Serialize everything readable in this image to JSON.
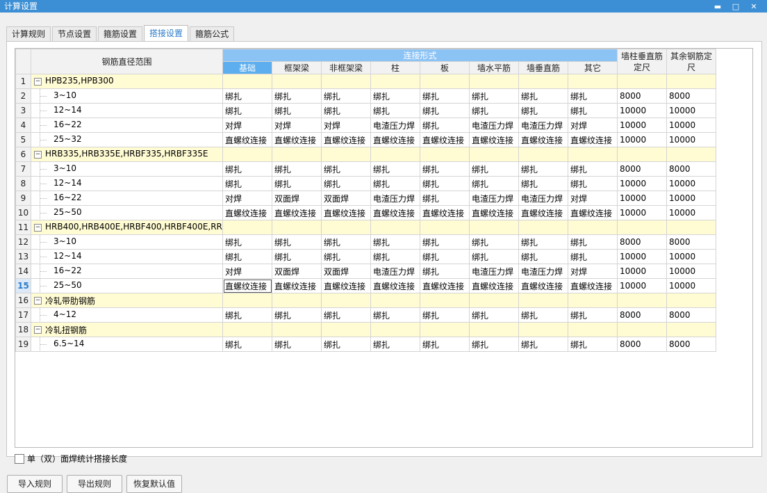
{
  "window": {
    "title": "计算设置",
    "controls": [
      "▬",
      "□",
      "✕"
    ]
  },
  "tabs": [
    {
      "label": "计算规则",
      "active": false
    },
    {
      "label": "节点设置",
      "active": false
    },
    {
      "label": "箍筋设置",
      "active": false
    },
    {
      "label": "搭接设置",
      "active": true
    },
    {
      "label": "箍筋公式",
      "active": false
    }
  ],
  "table": {
    "range_header": "钢筋直径范围",
    "connection_header": "连接形式",
    "sub_headers": [
      "基础",
      "框架梁",
      "非框架梁",
      "柱",
      "板",
      "墙水平筋",
      "墙垂直筋",
      "其它"
    ],
    "wall_col_header": "墙柱垂直筋定尺",
    "other_col_header": "其余钢筋定尺",
    "rows": [
      {
        "n": "1",
        "group": true,
        "label": "HPB235,HPB300"
      },
      {
        "n": "2",
        "range": "3~10",
        "cells": [
          "绑扎",
          "绑扎",
          "绑扎",
          "绑扎",
          "绑扎",
          "绑扎",
          "绑扎",
          "绑扎",
          "8000",
          "8000"
        ]
      },
      {
        "n": "3",
        "range": "12~14",
        "cells": [
          "绑扎",
          "绑扎",
          "绑扎",
          "绑扎",
          "绑扎",
          "绑扎",
          "绑扎",
          "绑扎",
          "10000",
          "10000"
        ]
      },
      {
        "n": "4",
        "range": "16~22",
        "cells": [
          "对焊",
          "对焊",
          "对焊",
          "电渣压力焊",
          "绑扎",
          "电渣压力焊",
          "电渣压力焊",
          "对焊",
          "10000",
          "10000"
        ]
      },
      {
        "n": "5",
        "range": "25~32",
        "cells": [
          "直螺纹连接",
          "直螺纹连接",
          "直螺纹连接",
          "直螺纹连接",
          "直螺纹连接",
          "直螺纹连接",
          "直螺纹连接",
          "直螺纹连接",
          "10000",
          "10000"
        ]
      },
      {
        "n": "6",
        "group": true,
        "label": "HRB335,HRB335E,HRBF335,HRBF335E"
      },
      {
        "n": "7",
        "range": "3~10",
        "cells": [
          "绑扎",
          "绑扎",
          "绑扎",
          "绑扎",
          "绑扎",
          "绑扎",
          "绑扎",
          "绑扎",
          "8000",
          "8000"
        ]
      },
      {
        "n": "8",
        "range": "12~14",
        "cells": [
          "绑扎",
          "绑扎",
          "绑扎",
          "绑扎",
          "绑扎",
          "绑扎",
          "绑扎",
          "绑扎",
          "10000",
          "10000"
        ]
      },
      {
        "n": "9",
        "range": "16~22",
        "cells": [
          "对焊",
          "双面焊",
          "双面焊",
          "电渣压力焊",
          "绑扎",
          "电渣压力焊",
          "电渣压力焊",
          "对焊",
          "10000",
          "10000"
        ]
      },
      {
        "n": "10",
        "range": "25~50",
        "cells": [
          "直螺纹连接",
          "直螺纹连接",
          "直螺纹连接",
          "直螺纹连接",
          "直螺纹连接",
          "直螺纹连接",
          "直螺纹连接",
          "直螺纹连接",
          "10000",
          "10000"
        ]
      },
      {
        "n": "11",
        "group": true,
        "label": "HRB400,HRB400E,HRBF400,HRBF400E,RR..."
      },
      {
        "n": "12",
        "range": "3~10",
        "cells": [
          "绑扎",
          "绑扎",
          "绑扎",
          "绑扎",
          "绑扎",
          "绑扎",
          "绑扎",
          "绑扎",
          "8000",
          "8000"
        ]
      },
      {
        "n": "13",
        "range": "12~14",
        "cells": [
          "绑扎",
          "绑扎",
          "绑扎",
          "绑扎",
          "绑扎",
          "绑扎",
          "绑扎",
          "绑扎",
          "10000",
          "10000"
        ]
      },
      {
        "n": "14",
        "range": "16~22",
        "cells": [
          "对焊",
          "双面焊",
          "双面焊",
          "电渣压力焊",
          "绑扎",
          "电渣压力焊",
          "电渣压力焊",
          "对焊",
          "10000",
          "10000"
        ]
      },
      {
        "n": "15",
        "range": "25~50",
        "selected": true,
        "cells": [
          "直螺纹连接",
          "直螺纹连接",
          "直螺纹连接",
          "直螺纹连接",
          "直螺纹连接",
          "直螺纹连接",
          "直螺纹连接",
          "直螺纹连接",
          "10000",
          "10000"
        ]
      },
      {
        "n": "16",
        "group": true,
        "label": "冷轧带肋钢筋"
      },
      {
        "n": "17",
        "range": "4~12",
        "cells": [
          "绑扎",
          "绑扎",
          "绑扎",
          "绑扎",
          "绑扎",
          "绑扎",
          "绑扎",
          "绑扎",
          "8000",
          "8000"
        ]
      },
      {
        "n": "18",
        "group": true,
        "label": "冷轧扭钢筋"
      },
      {
        "n": "19",
        "range": "6.5~14",
        "cells": [
          "绑扎",
          "绑扎",
          "绑扎",
          "绑扎",
          "绑扎",
          "绑扎",
          "绑扎",
          "绑扎",
          "8000",
          "8000"
        ]
      }
    ]
  },
  "checkbox_label": "单（双）面焊统计搭接长度",
  "buttons": {
    "import": "导入规则",
    "export": "导出规则",
    "restore": "恢复默认值"
  },
  "expander_symbol": "−"
}
